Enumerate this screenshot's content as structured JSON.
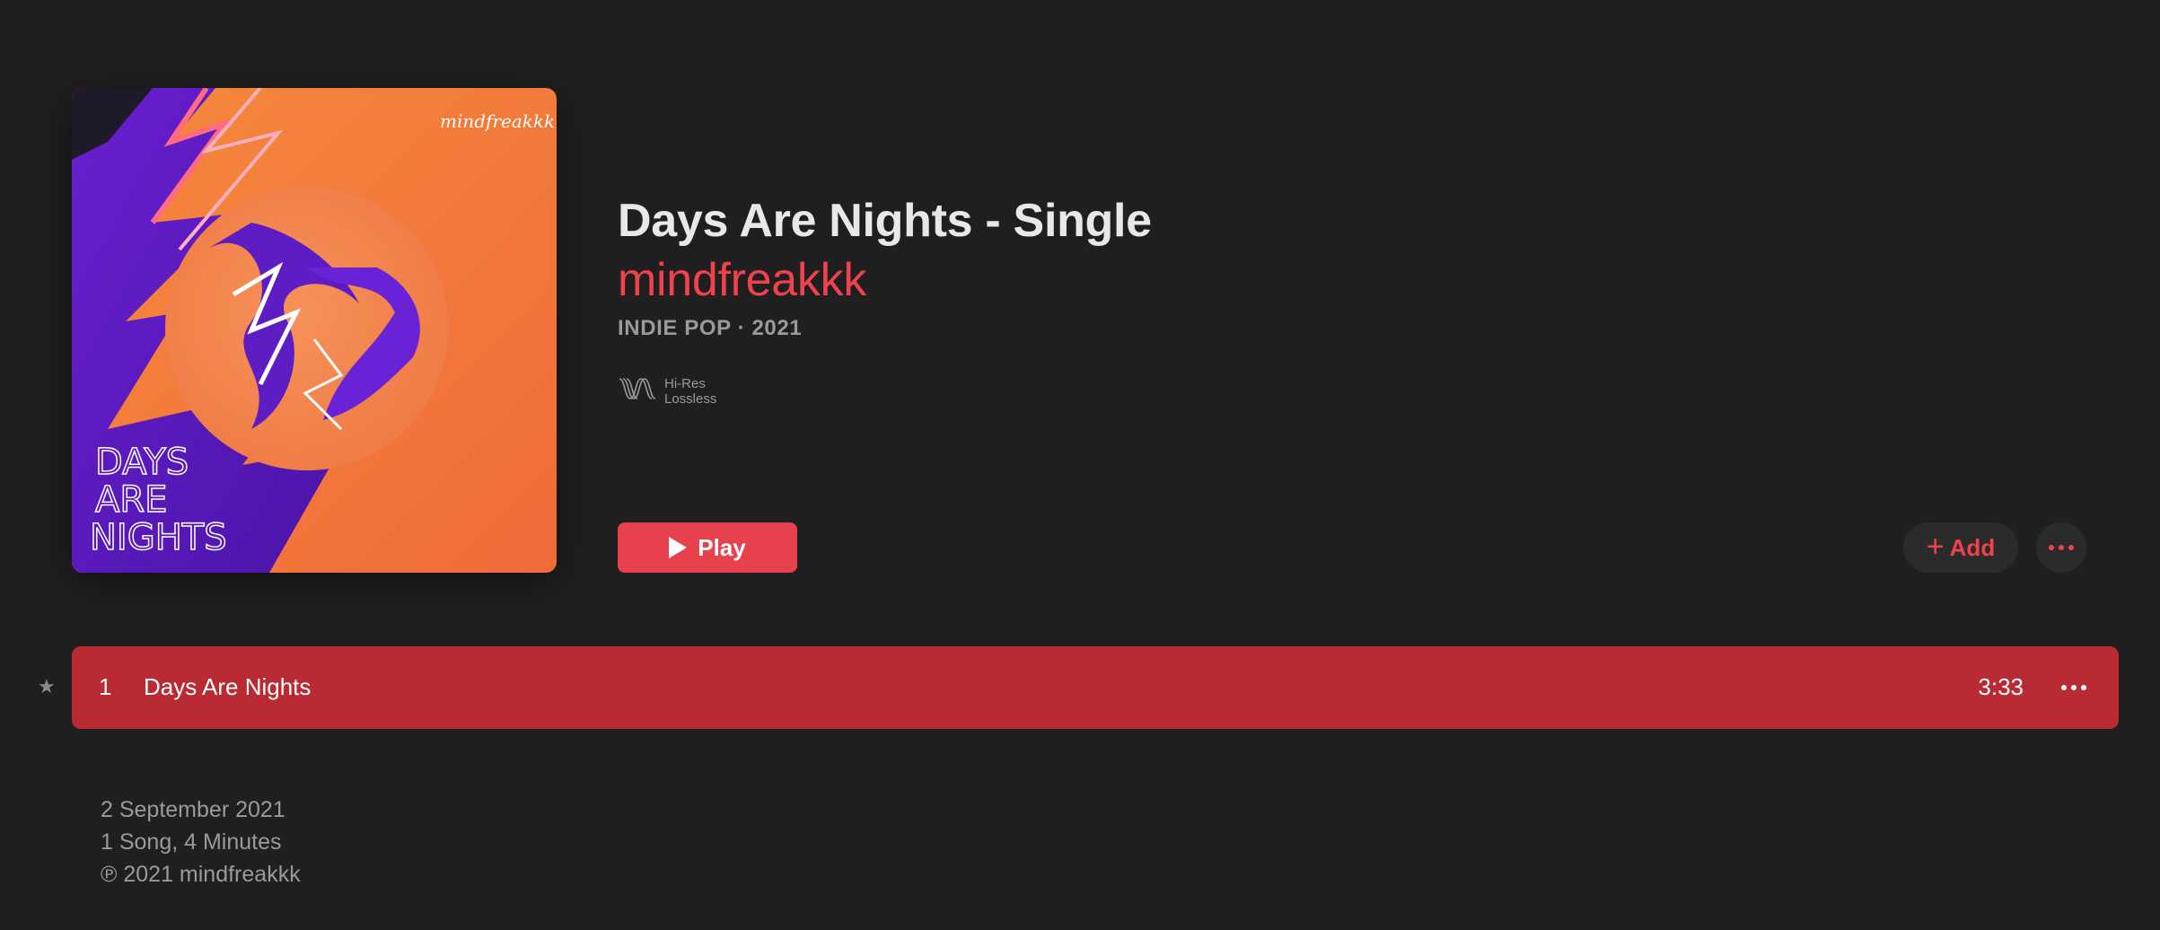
{
  "album": {
    "title": "Days Are Nights - Single",
    "artist": "mindfreakkk",
    "meta": "INDIE POP · 2021",
    "badge": {
      "icon": "hi-res-lossless-icon",
      "line1": "Hi-Res",
      "line2": "Lossless"
    },
    "artwork": {
      "signature": "mindfreakkk",
      "cover_text": [
        "DAYS",
        "ARE",
        "NIGHTS"
      ]
    }
  },
  "actions": {
    "play_label": "Play",
    "add_label": "Add",
    "add_icon": "+"
  },
  "tracks": [
    {
      "number": "1",
      "title": "Days Are Nights",
      "duration": "3:33",
      "favorite_icon": "★"
    }
  ],
  "footer": {
    "release_date": "2 September 2021",
    "summary": "1 Song, 4 Minutes",
    "copyright": "℗ 2021 mindfreakkk"
  },
  "colors": {
    "background": "#1f1f1f",
    "accent": "#f0414e",
    "selected_row": "#b92a33",
    "secondary_text": "#9a9a9a"
  }
}
